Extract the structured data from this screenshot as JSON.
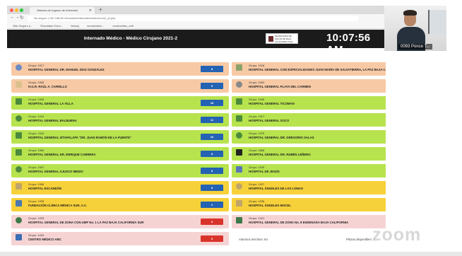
{
  "browser": {
    "tab_title": "Sistema de Ingreso de Internado",
    "address": "No seguro | 192.168.55.1/examen/internadomedico/crono_pr.php",
    "bookmarks": [
      "Sitio Seguro s...",
      "Resultado Extra...",
      "Notary",
      "ecetramites ...",
      "ecetramites_edit"
    ]
  },
  "header": {
    "title": "Internado Médico - Médico Cirujano 2021-2",
    "logo_text": "SECRETARÍA DE SALUD DE BAJA CALIFORNIA SUR",
    "clock": "10:07:56 AM"
  },
  "hospitals": [
    {
      "group": "Grupo: 1017",
      "name": "HOSPITAL GENERAL DR. MANUEL DÍAZ GONZÁLEZ",
      "count": "8",
      "color": "#f7c9a5",
      "btn": "#2462b3",
      "icon": "#6a8bc4"
    },
    {
      "group": "Grupo: 1018",
      "name": "HOSPITAL GENERAL CON ESPECIALIDADES JUAN MARÍA DE SALVATIERRA, LA PAZ BAJA CALIFORNIA SUR",
      "count": "8",
      "color": "#f7c9a5",
      "btn": "#2462b3",
      "icon": "#8ba36a"
    },
    {
      "group": "Grupo: 1983",
      "name": "H.G.R. RAÚL A. CARRILLO",
      "count": "5",
      "color": "#f7c9a5",
      "btn": "#2462b3",
      "icon": "#d9c08c"
    },
    {
      "group": "Grupo: 1953",
      "name": "HOSPITAL GENERAL PLAYA DEL CARMEN",
      "count": "1",
      "color": "#f7c9a5",
      "btn": "#2462b3",
      "icon": "#888888"
    },
    {
      "group": "Grupo: 1939",
      "name": "HOSPITAL GENERAL LA VILLA",
      "count": "18",
      "color": "#b7e34e",
      "btn": "#2462b3",
      "icon": "#4c8b3c"
    },
    {
      "group": "Grupo: 1936",
      "name": "HOSPITAL GENERAL TICOMAN",
      "count": "12",
      "color": "#b7e34e",
      "btn": "#2462b3",
      "icon": "#4c8b3c"
    },
    {
      "group": "Grupo: 1919",
      "name": "HOSPITAL GENERAL BALBUENA",
      "count": "11",
      "color": "#b7e34e",
      "btn": "#2462b3",
      "icon": "#4c8b3c"
    },
    {
      "group": "Grupo: 1917",
      "name": "HOSPITAL GENERAL XOCO",
      "count": "12",
      "color": "#b7e34e",
      "btn": "#2462b3",
      "icon": "#4c8b3c"
    },
    {
      "group": "Grupo: 1918",
      "name": "HOSPITAL GENERAL IZTAPALAPA \"DR. JUAN RAMÓN DE LA FUENTE\"",
      "count": "16",
      "color": "#b7e34e",
      "btn": "#2462b3",
      "icon": "#4c8b3c"
    },
    {
      "group": "Grupo: 1975",
      "name": "HOSPITAL GENERAL DR. GREGORIO SALAS",
      "count": "8",
      "color": "#b7e34e",
      "btn": "#2462b3",
      "icon": "#4c8b3c"
    },
    {
      "group": "Grupo: 1969",
      "name": "HOSPITAL GENERAL DR. ENRIQUE CABRERA",
      "count": "8",
      "color": "#b7e34e",
      "btn": "#2462b3",
      "icon": "#4c8b3c"
    },
    {
      "group": "Grupo: 1888",
      "name": "HOSPITAL GENERAL DR. RUBÉN LEÑERO",
      "count": "8",
      "color": "#b7e34e",
      "btn": "#2462b3",
      "icon": "#222222"
    },
    {
      "group": "Grupo: 1987",
      "name": "HOSPITAL GENERAL AJUSCO MEDIO",
      "count": "8",
      "color": "#b7e34e",
      "btn": "#2462b3",
      "icon": "#4c8b3c"
    },
    {
      "group": "Grupo: 1939",
      "name": "HOSPITAL DE JESÚS",
      "count": "14",
      "color": "#b7e34e",
      "btn": "#2462b3",
      "icon": "#5a78b8"
    },
    {
      "group": "Grupo: 1996",
      "name": "HOSPITAL ESCANDÓN",
      "count": "8",
      "color": "#f7d13a",
      "btn": "#2462b3",
      "icon": "#bfa56a"
    },
    {
      "group": "Grupo: 1927",
      "name": "HOSPITAL ÁNGELES DE LAS LOMAS",
      "count": "2",
      "color": "#f7d13a",
      "btn": "#2462b3",
      "icon": "#bfa56a"
    },
    {
      "group": "Grupo: 1935",
      "name": "FUNDACIÓN CLÍNICA MÉDICA SUR, A.C.",
      "count": "2",
      "color": "#f7d13a",
      "btn": "#2462b3",
      "icon": "#4a78b0"
    },
    {
      "group": "Grupo: 1938",
      "name": "HOSPITAL ÁNGELES MOCEL",
      "count": "2",
      "color": "#f7d13a",
      "btn": "#2462b3",
      "icon": "#bfa56a"
    },
    {
      "group": "Grupo: 1933",
      "name": "HOSPITAL GENERAL DE ZONA CON UMF No. 1 LA PAZ BAJA CALIFORNIA SUR",
      "count": "0",
      "color": "#f6d3d3",
      "btn": "#d9342b",
      "icon": "#3d7a4a"
    },
    {
      "group": "Grupo: 1021",
      "name": "HOSPITAL GENERAL DE ZONA No. 8 ENSENADA BAJA CALIFORNIA",
      "count": "0",
      "color": "#f6d3d3",
      "btn": "#d9342b",
      "icon": "#3d7a4a"
    },
    {
      "group": "Grupo: 1034",
      "name": "CENTRO MÉDICO ABC",
      "count": "0",
      "color": "#f6d3d3",
      "btn": "#d9342b",
      "icon": "#3b6fb5"
    }
  ],
  "footer": {
    "inscritos": "Alumnos inscritos: 64",
    "disponibles": "Plazas disponibles: 1"
  },
  "participant": {
    "name": "0093 Ponce T..."
  },
  "watermark": "zoom"
}
